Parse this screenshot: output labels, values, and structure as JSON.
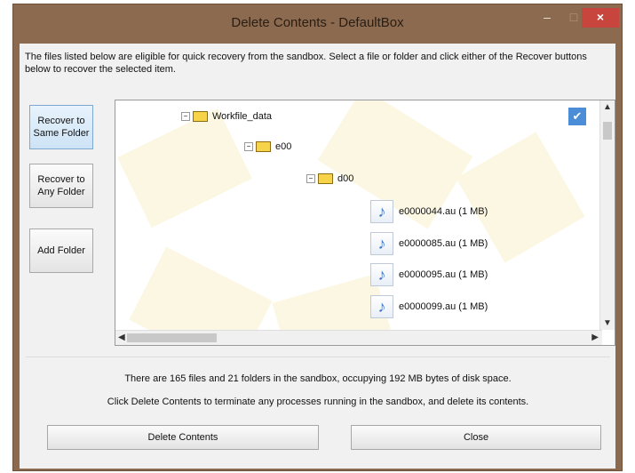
{
  "window": {
    "title": "Delete Contents - DefaultBox",
    "min_symbol": "–",
    "max_symbol": "□",
    "close_symbol": "×"
  },
  "header": {
    "description": "The files listed below are eligible for quick recovery from the sandbox.  Select a file or folder and click either of the Recover buttons below to recover the selected item."
  },
  "side_buttons": [
    {
      "label": "Recover to Same Folder"
    },
    {
      "label": "Recover to Any Folder"
    },
    {
      "label": "Add Folder"
    }
  ],
  "tree": {
    "folders": [
      {
        "name": "Workfile_data"
      },
      {
        "name": "e00"
      },
      {
        "name": "d00"
      }
    ],
    "files": [
      {
        "name": "e0000044.au  (1 MB)"
      },
      {
        "name": "e0000085.au  (1 MB)"
      },
      {
        "name": "e0000095.au  (1 MB)"
      },
      {
        "name": "e0000099.au  (1 MB)"
      }
    ],
    "checkbox": "✔"
  },
  "status": {
    "line1": "There are 165 files and 21 folders in the sandbox, occupying 192 MB bytes of disk space.",
    "line2": "Click Delete Contents to terminate any processes running in the sandbox, and delete its contents."
  },
  "footer_buttons": {
    "delete": "Delete Contents",
    "close": "Close"
  },
  "colors": {
    "titlebar": "#8c6a50",
    "close": "#c7453d",
    "folder": "#f7d34a",
    "accent": "#4c8dd8"
  }
}
